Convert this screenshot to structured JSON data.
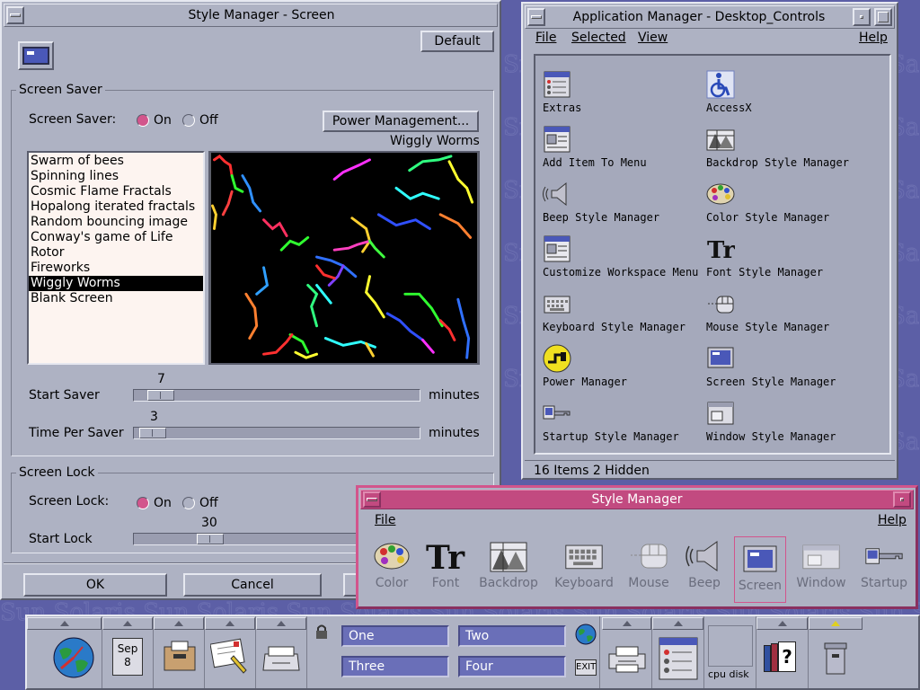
{
  "style_screen": {
    "title": "Style Manager - Screen",
    "default_label": "Default",
    "screen_saver_group": "Screen Saver",
    "screen_saver_label": "Screen Saver:",
    "on_label": "On",
    "off_label": "Off",
    "power_button": "Power Management...",
    "preview_caption": "Wiggly Worms",
    "savers": [
      "Swarm of bees",
      "Spinning lines",
      "Cosmic Flame Fractals",
      "Hopalong iterated fractals",
      "Random bouncing image",
      "Conway's game of Life",
      "Rotor",
      "Fireworks",
      "Wiggly Worms",
      "Blank Screen"
    ],
    "selected_saver": "Wiggly Worms",
    "start_saver_label": "Start Saver",
    "start_saver_value": "7",
    "time_per_saver_label": "Time Per Saver",
    "time_per_saver_value": "3",
    "minutes_label": "minutes",
    "screen_lock_group": "Screen Lock",
    "screen_lock_label": "Screen Lock:",
    "start_lock_label": "Start Lock",
    "start_lock_value": "30",
    "ok_label": "OK",
    "cancel_label": "Cancel"
  },
  "app_manager": {
    "title": "Application Manager - Desktop_Controls",
    "menu": {
      "file": "File",
      "selected": "Selected",
      "view": "View",
      "help": "Help"
    },
    "items": [
      "Extras",
      "AccessX",
      "Add Item To Menu",
      "Backdrop Style Manager",
      "Beep Style Manager",
      "Color Style Manager",
      "Customize Workspace Menu",
      "Font Style Manager",
      "Keyboard Style Manager",
      "Mouse Style Manager",
      "Power Manager",
      "Screen Style Manager",
      "Startup Style Manager",
      "Window Style Manager"
    ],
    "status": "16 Items 2 Hidden"
  },
  "style_manager": {
    "title": "Style Manager",
    "file": "File",
    "help": "Help",
    "tools": [
      "Color",
      "Font",
      "Backdrop",
      "Keyboard",
      "Mouse",
      "Beep",
      "Screen",
      "Window",
      "Startup"
    ],
    "active_tool": "Screen"
  },
  "front_panel": {
    "date_month": "Sep",
    "date_day": "8",
    "workspaces": [
      "One",
      "Two",
      "Three",
      "Four"
    ],
    "exit_label": "EXIT",
    "cpu_disk_label": "cpu disk",
    "help_glyph": "?"
  },
  "colors": {
    "desktop": "#5c5fa6",
    "window": "#aeb2c3",
    "accent": "#d2558c",
    "workspace": "#6a6fb8"
  }
}
